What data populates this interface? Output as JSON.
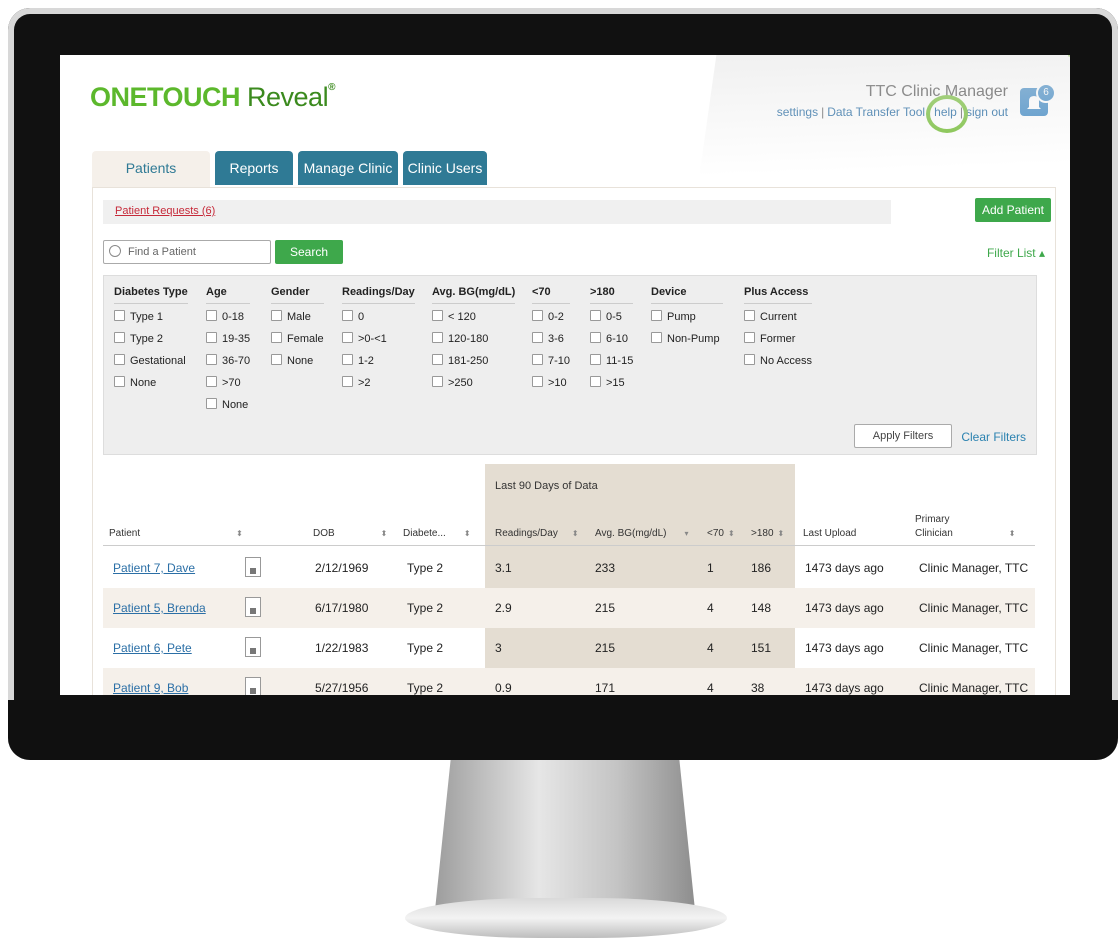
{
  "app": {
    "logo_main": "ONETOUCH",
    "logo_sub": "Reveal",
    "clinic_name": "TTC Clinic Manager",
    "links": [
      "settings",
      "Data Transfer Tool",
      "help",
      "sign out"
    ],
    "notification_count": "6"
  },
  "tabs": [
    "Patients",
    "Reports",
    "Manage Clinic",
    "Clinic Users"
  ],
  "patients_view": {
    "requests_label": "Patient Requests (6)",
    "add_patient_label": "Add Patient",
    "search_placeholder": "Find a Patient",
    "search_label": "Search",
    "filter_list_label": "Filter List ▴"
  },
  "filters": {
    "apply_label": "Apply Filters",
    "clear_label": "Clear Filters",
    "groups": [
      {
        "title": "Diabetes Type",
        "options": [
          "Type 1",
          "Type 2",
          "Gestational",
          "None"
        ]
      },
      {
        "title": "Age",
        "options": [
          "0-18",
          "19-35",
          "36-70",
          ">70",
          "None"
        ]
      },
      {
        "title": "Gender",
        "options": [
          "Male",
          "Female",
          "None"
        ]
      },
      {
        "title": "Readings/Day",
        "options": [
          "0",
          ">0-<1",
          "1-2",
          ">2"
        ]
      },
      {
        "title": "Avg. BG(mg/dL)",
        "options": [
          "< 120",
          "120-180",
          "181-250",
          ">250"
        ]
      },
      {
        "title": "<70",
        "options": [
          "0-2",
          "3-6",
          "7-10",
          ">10"
        ]
      },
      {
        "title": ">180",
        "options": [
          "0-5",
          "6-10",
          "11-15",
          ">15"
        ]
      },
      {
        "title": "Device",
        "options": [
          "Pump",
          "Non-Pump"
        ]
      },
      {
        "title": "Plus Access",
        "options": [
          "Current",
          "Former",
          "No Access"
        ]
      }
    ]
  },
  "table": {
    "band_title": "Last 90 Days of Data",
    "columns": [
      "Patient",
      "DOB",
      "Diabete...",
      "Readings/Day",
      "Avg. BG(mg/dL)",
      "<70",
      ">180",
      "Last Upload",
      "Primary",
      "Clinician"
    ],
    "rows": [
      {
        "patient": "Patient 7, Dave",
        "dob": "2/12/1969",
        "type": "Type 2",
        "readings": "3.1",
        "avg": "233",
        "low": "1",
        "high": "186",
        "upload": "1473 days ago",
        "clinician": "Clinic Manager, TTC"
      },
      {
        "patient": "Patient 5, Brenda",
        "dob": "6/17/1980",
        "type": "Type 2",
        "readings": "2.9",
        "avg": "215",
        "low": "4",
        "high": "148",
        "upload": "1473 days ago",
        "clinician": "Clinic Manager, TTC"
      },
      {
        "patient": "Patient 6, Pete",
        "dob": "1/22/1983",
        "type": "Type 2",
        "readings": "3",
        "avg": "215",
        "low": "4",
        "high": "151",
        "upload": "1473 days ago",
        "clinician": "Clinic Manager, TTC"
      },
      {
        "patient": "Patient 9, Bob",
        "dob": "5/27/1956",
        "type": "Type 2",
        "readings": "0.9",
        "avg": "171",
        "low": "4",
        "high": "38",
        "upload": "1473 days ago",
        "clinician": "Clinic Manager, TTC"
      }
    ]
  }
}
